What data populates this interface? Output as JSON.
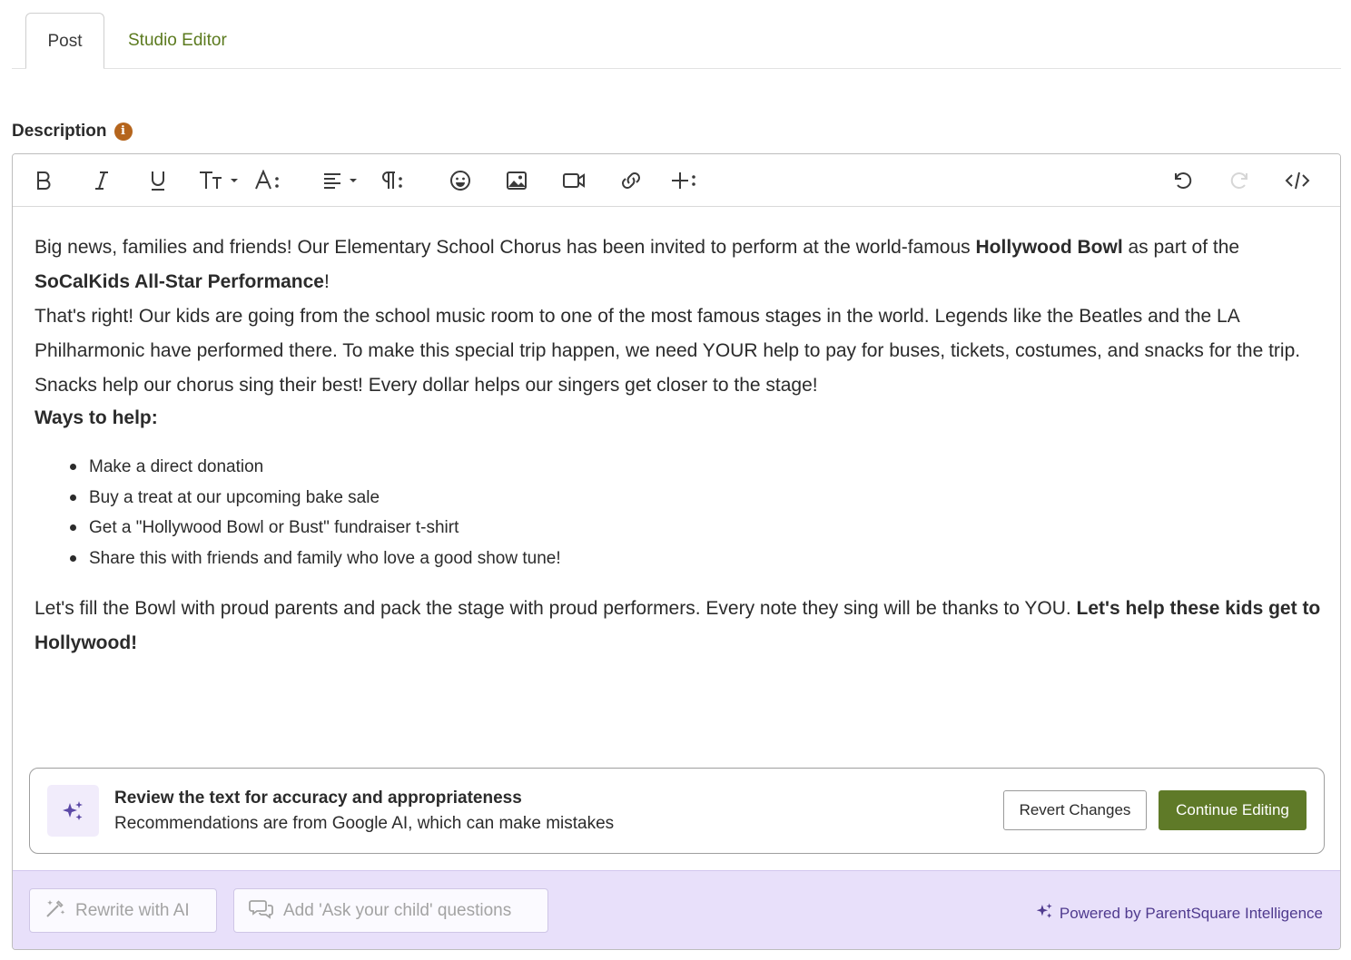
{
  "tabs": [
    {
      "label": "Post",
      "active": true
    },
    {
      "label": "Studio Editor",
      "active": false
    }
  ],
  "description": {
    "label": "Description",
    "info_icon": "info-icon"
  },
  "toolbar": {
    "buttons": [
      "bold",
      "italic",
      "underline",
      "font-size",
      "text-color",
      "align",
      "paragraph-format",
      "emoji",
      "insert-image",
      "insert-video",
      "insert-link",
      "more",
      "undo",
      "redo",
      "code-view"
    ],
    "font_size_label": "TT",
    "text_style_label": "A:",
    "paragraph_label": "¶:",
    "more_label": "+:"
  },
  "content": {
    "p1_a": "Big news, families and friends! Our Elementary School Chorus has been invited to perform at the world-famous ",
    "p1_bold1": "Hollywood Bowl",
    "p1_b": " as part of the ",
    "p1_bold2": "SoCalKids All-Star Performance",
    "p1_c": "!",
    "p2": "That's right! Our kids are going from the school music room to one of the most famous stages in the world. Legends like the Beatles and the LA Philharmonic have performed there. To make this special trip happen, we need YOUR help to pay for buses, tickets, costumes, and snacks for the trip. Snacks help our chorus sing their best! Every dollar helps our singers get closer to the stage!",
    "ways_heading": "Ways to help:",
    "list": [
      "Make a direct donation",
      "Buy a treat at our upcoming bake sale",
      "Get a \"Hollywood Bowl or Bust\" fundraiser t-shirt",
      "Share this with friends and family who love a good show tune!"
    ],
    "p3_a": "Let's fill the Bowl with proud parents and pack the stage with proud performers. Every note they sing will be thanks to YOU. ",
    "p3_bold": "Let's help these kids get to Hollywood!"
  },
  "review": {
    "title": "Review the text for accuracy and appropriateness",
    "subtitle": "Recommendations are from Google AI, which can make mistakes",
    "revert_label": "Revert Changes",
    "continue_label": "Continue Editing"
  },
  "ai_bar": {
    "rewrite_label": "Rewrite with AI",
    "ask_label": "Add 'Ask your child' questions",
    "powered_label": "Powered by ParentSquare Intelligence"
  },
  "colors": {
    "accent_green": "#5f7a28",
    "tab_green": "#5b7a1e",
    "info_orange": "#b5651d",
    "ai_purple": "#4f3a8e",
    "ai_bar_bg": "#e8e0fa"
  }
}
